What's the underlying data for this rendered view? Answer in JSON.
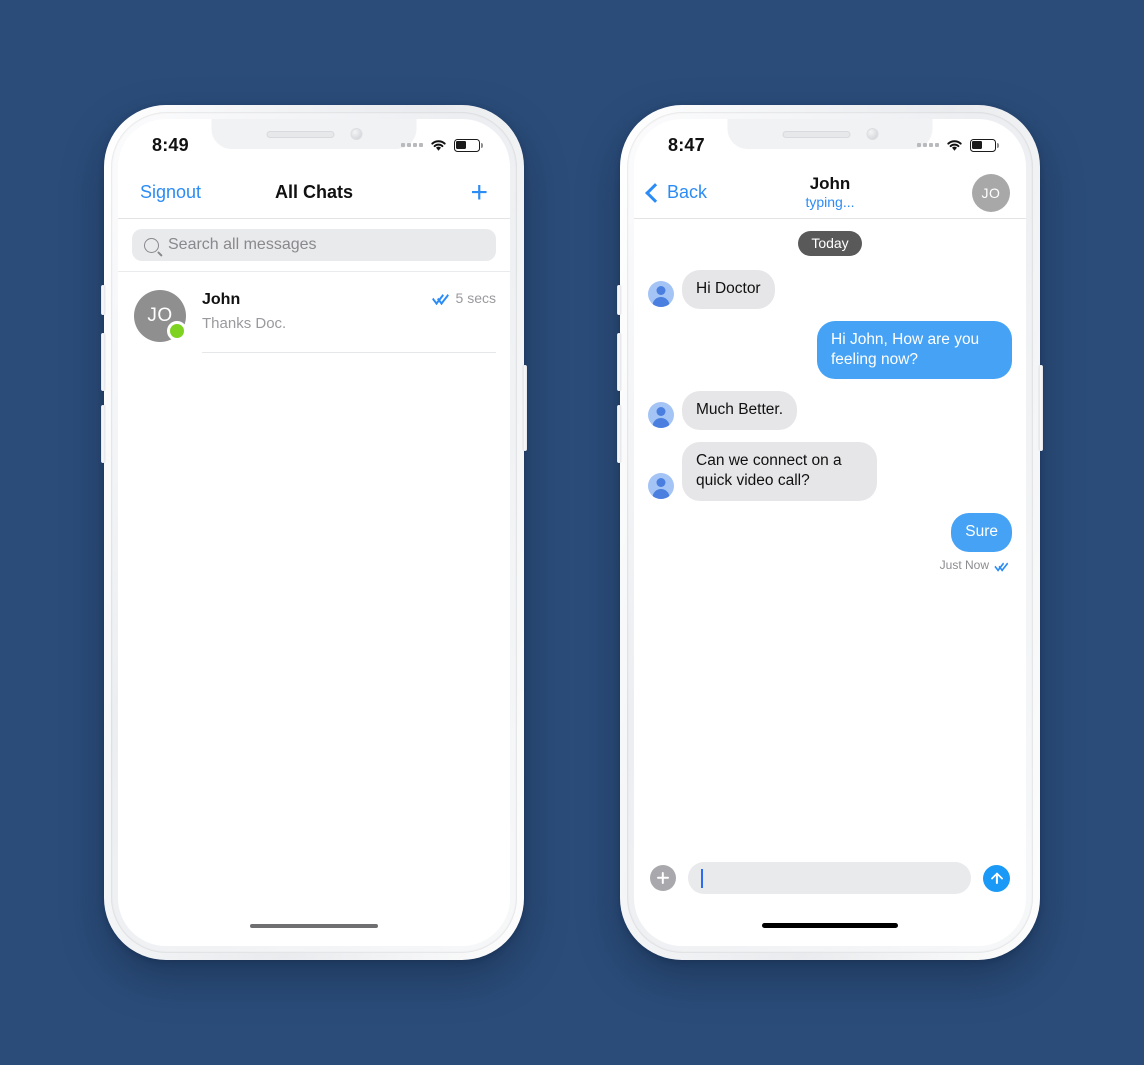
{
  "theme": {
    "background": "#2b4c79",
    "accent_blue": "#2c8cf5",
    "bubble_blue": "#45a2f5",
    "bubble_gray": "#e6e6e8",
    "online_green": "#7ed321",
    "avatar_gray": "#8f8f8f"
  },
  "phone_left": {
    "status_bar": {
      "time": "8:49",
      "signal_icon": "signal-dots-icon",
      "wifi_icon": "wifi-icon",
      "battery_icon": "battery-icon"
    },
    "nav": {
      "left_label": "Signout",
      "title": "All Chats",
      "plus_label": "+"
    },
    "search": {
      "placeholder": "Search all messages",
      "icon": "search-icon"
    },
    "chats": [
      {
        "initials": "JO",
        "name": "John",
        "snippet": "Thanks Doc.",
        "time": "5 secs",
        "status_icon": "double-check-icon",
        "online": true
      }
    ]
  },
  "phone_right": {
    "status_bar": {
      "time": "8:47",
      "signal_icon": "signal-dots-icon",
      "wifi_icon": "wifi-icon",
      "battery_icon": "battery-icon"
    },
    "nav": {
      "back_label": "Back",
      "title": "John",
      "subtitle": "typing...",
      "avatar_initials": "JO"
    },
    "thread": {
      "day_badge": "Today",
      "messages": [
        {
          "direction": "in",
          "text": "Hi Doctor"
        },
        {
          "direction": "out",
          "text": "Hi John, How are you feeling now?"
        },
        {
          "direction": "in",
          "text": "Much Better."
        },
        {
          "direction": "in",
          "text": "Can we connect on a quick video call?"
        },
        {
          "direction": "out",
          "text": "Sure",
          "meta_time": "Just Now",
          "meta_icon": "double-check-icon"
        }
      ]
    },
    "composer": {
      "attach_label": "+",
      "input_value": "",
      "placeholder": "",
      "send_icon": "arrow-up-icon"
    }
  }
}
